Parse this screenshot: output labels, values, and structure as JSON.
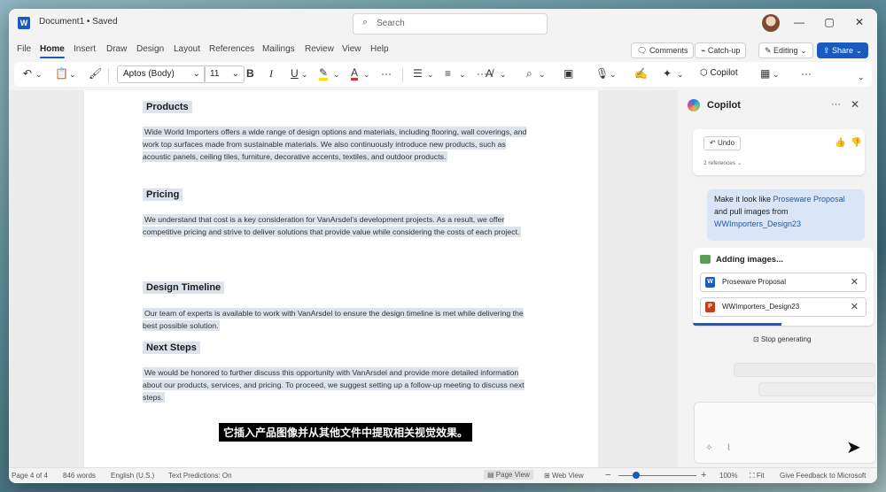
{
  "titlebar": {
    "app_icon_letter": "W",
    "doc_title": "Document1 • Saved",
    "search_placeholder": "Search",
    "window_controls": {
      "minimize": "—",
      "maximize": "▢",
      "close": "✕"
    }
  },
  "menu": {
    "tabs": [
      "File",
      "Home",
      "Insert",
      "Draw",
      "Design",
      "Layout",
      "References",
      "Mailings",
      "Review",
      "View",
      "Help"
    ],
    "active_tab": "Home",
    "right_buttons": {
      "comments": "Comments",
      "catchup": "Catch-up",
      "editing": "Editing",
      "share": "Share"
    }
  },
  "toolbar": {
    "font_name": "Aptos (Body)",
    "font_size": "11",
    "bold": "B",
    "italic": "I",
    "underline": "U",
    "copilot_label": "Copilot"
  },
  "document": {
    "sections": [
      {
        "heading": "Products",
        "body": "Wide World Importers offers a wide range of design options and materials, including flooring, wall coverings, and work top surfaces made from sustainable materials. We also continuously introduce new products, such as acoustic panels, ceiling tiles, furniture, decorative accents, textiles, and outdoor products."
      },
      {
        "heading": "Pricing",
        "body": "We understand that cost is a key consideration for VanArsdel's development projects. As a result, we offer competitive pricing and strive to deliver solutions that provide value while considering the costs of each project."
      },
      {
        "heading": "Design Timeline",
        "body": "Our team of experts is available to work with VanArsdel to ensure the design timeline is met while delivering the best possible solution."
      },
      {
        "heading": "Next Steps",
        "body": "We would be honored to further discuss this opportunity with VanArsdel and provide more detailed information about our products, services, and pricing. To proceed, we suggest setting up a follow-up meeting to discuss next steps."
      }
    ]
  },
  "caption": "它插入产品图像并从其他文件中提取相关视觉效果。",
  "copilot": {
    "title": "Copilot",
    "undo_label": "Undo",
    "references_label": "2 references",
    "user_message": {
      "prefix": "Make it look like ",
      "link1": "Proseware Proposal",
      "middle": " and pull images from ",
      "link2": "WWImporters_Design23"
    },
    "status_title": "Adding images...",
    "files": [
      {
        "name": "Proseware Proposal",
        "type": "word"
      },
      {
        "name": "WWImporters_Design23",
        "type": "powerpoint"
      }
    ],
    "stop_label": "Stop generating"
  },
  "statusbar": {
    "page": "Page 4 of 4",
    "words": "846 words",
    "language": "English (U.S.)",
    "predictions": "Text Predictions: On",
    "page_view": "Page View",
    "web_view": "Web View",
    "zoom_minus": "−",
    "zoom_plus": "+",
    "zoom": "100%",
    "fit": "Fit",
    "feedback": "Give Feedback to Microsoft"
  },
  "colors": {
    "accent": "#185abd",
    "highlight": "#dde3ed",
    "user_bubble": "#dae6f7"
  }
}
